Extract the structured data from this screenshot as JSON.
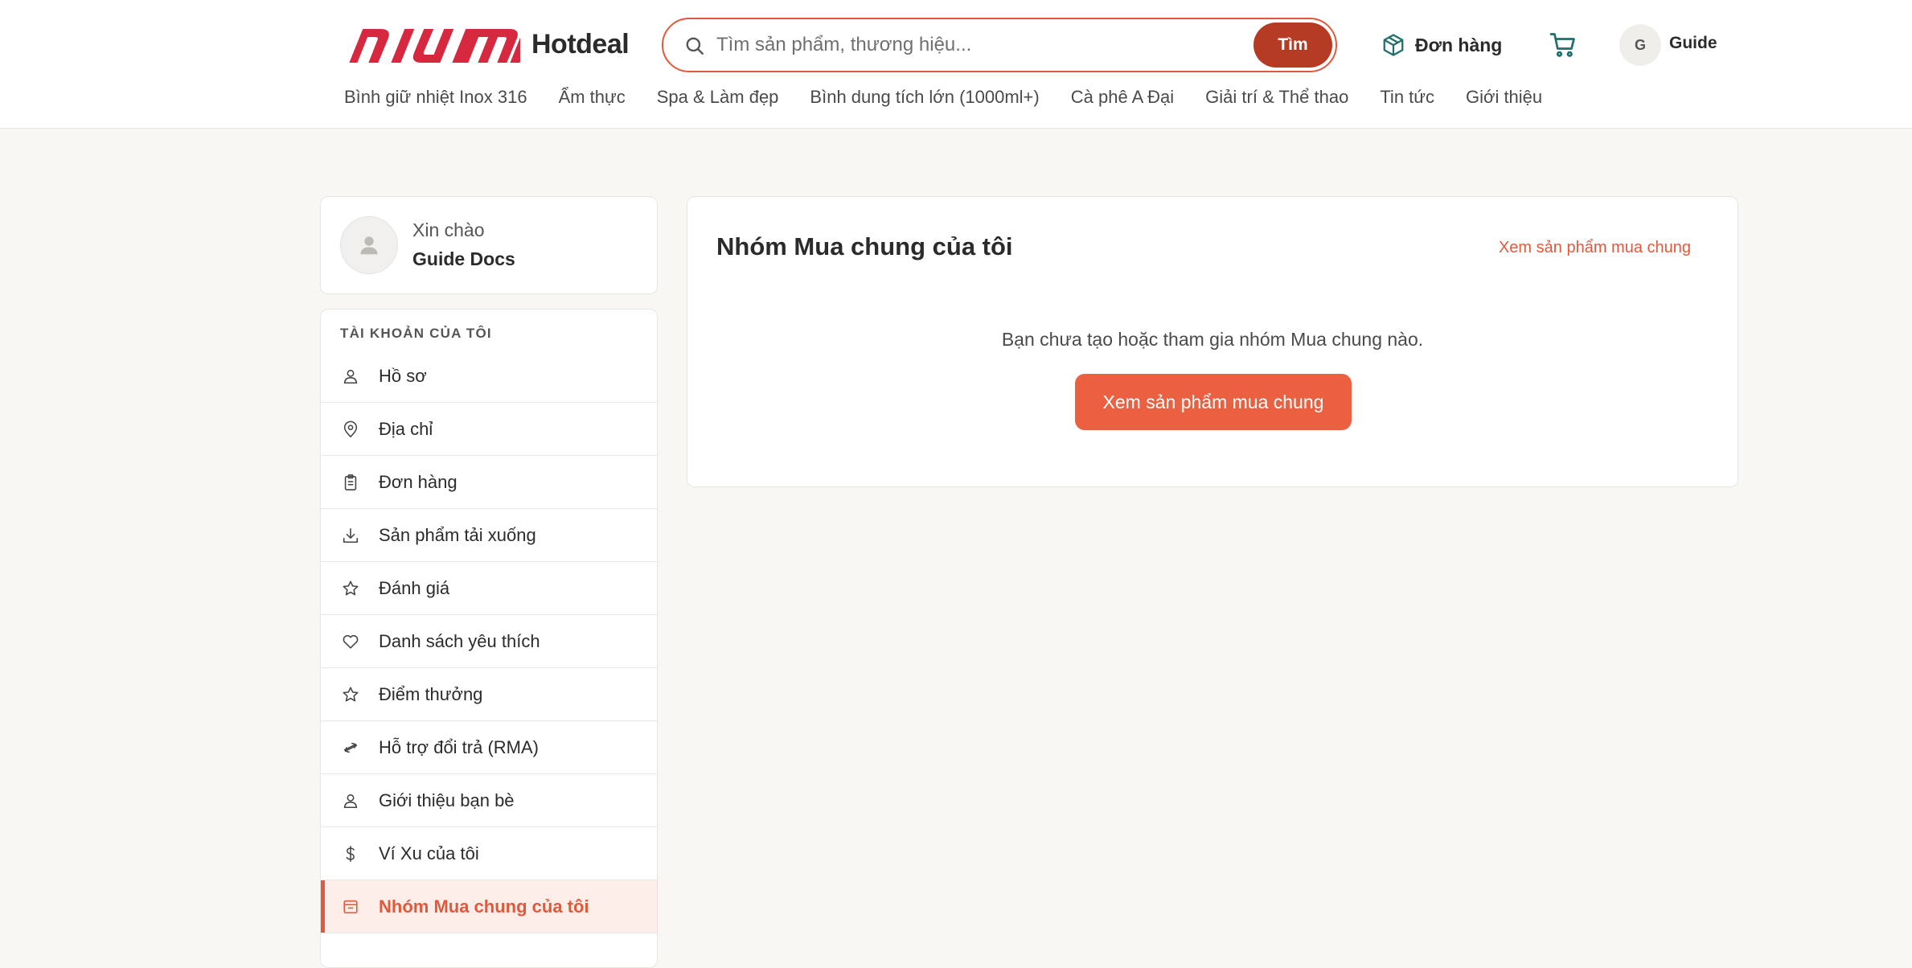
{
  "brand": {
    "logo_text": "NIUMI",
    "name": "Hotdeal",
    "accent_color": "#e0593c",
    "logo_color": "#d6283f"
  },
  "search": {
    "placeholder": "Tìm sản phẩm, thương hiệu...",
    "button_label": "Tìm"
  },
  "header": {
    "orders_label": "Đơn hàng",
    "avatar_initial": "G",
    "user_name": "Guide"
  },
  "nav": [
    "Bình giữ nhiệt Inox 316",
    "Ẩm thực",
    "Spa & Làm đẹp",
    "Bình dung tích lớn (1000ml+)",
    "Cà phê A Đại",
    "Giải trí & Thể thao",
    "Tin tức",
    "Giới thiệu"
  ],
  "sidebar": {
    "greeting": "Xin chào",
    "full_name": "Guide Docs",
    "section_title": "TÀI KHOẢN CỦA TÔI",
    "items": [
      {
        "label": "Hồ sơ",
        "icon": "user-icon"
      },
      {
        "label": "Địa chỉ",
        "icon": "location-pin-icon"
      },
      {
        "label": "Đơn hàng",
        "icon": "clipboard-icon"
      },
      {
        "label": "Sản phẩm tải xuống",
        "icon": "download-icon"
      },
      {
        "label": "Đánh giá",
        "icon": "star-icon"
      },
      {
        "label": "Danh sách yêu thích",
        "icon": "heart-icon"
      },
      {
        "label": "Điểm thưởng",
        "icon": "star-icon"
      },
      {
        "label": "Hỗ trợ đổi trả (RMA)",
        "icon": "exchange-icon"
      },
      {
        "label": "Giới thiệu bạn bè",
        "icon": "user-icon"
      },
      {
        "label": "Ví Xu của tôi",
        "icon": "dollar-icon"
      },
      {
        "label": "Nhóm Mua chung của tôi",
        "icon": "group-buy-icon",
        "active": true
      }
    ]
  },
  "main": {
    "title": "Nhóm Mua chung của tôi",
    "top_link": "Xem sản phẩm mua chung",
    "empty_message": "Bạn chưa tạo hoặc tham gia nhóm Mua chung nào.",
    "cta_label": "Xem sản phẩm mua chung"
  }
}
